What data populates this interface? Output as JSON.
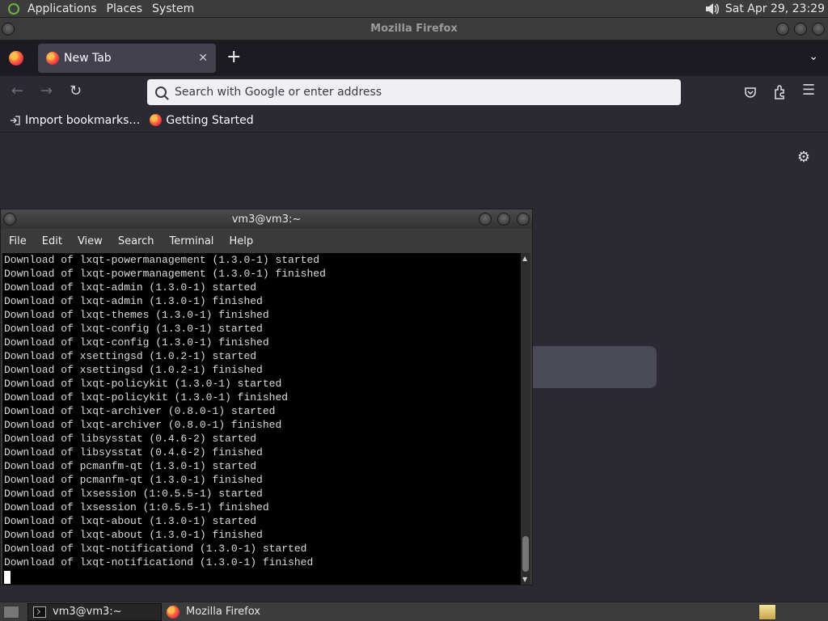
{
  "top_panel": {
    "menus": [
      "Applications",
      "Places",
      "System"
    ],
    "clock": "Sat Apr 29, 23:29"
  },
  "firefox": {
    "window_title": "Mozilla Firefox",
    "tab_title": "New Tab",
    "url_placeholder": "Search with Google or enter address",
    "bookmarks": [
      "Import bookmarks…",
      "Getting Started"
    ]
  },
  "terminal": {
    "title": "vm3@vm3:~",
    "menus": [
      "File",
      "Edit",
      "View",
      "Search",
      "Terminal",
      "Help"
    ],
    "lines": [
      "Download of lxqt-powermanagement (1.3.0-1) started",
      "Download of lxqt-powermanagement (1.3.0-1) finished",
      "Download of lxqt-admin (1.3.0-1) started",
      "Download of lxqt-admin (1.3.0-1) finished",
      "Download of lxqt-themes (1.3.0-1) finished",
      "Download of lxqt-config (1.3.0-1) started",
      "Download of lxqt-config (1.3.0-1) finished",
      "Download of xsettingsd (1.0.2-1) started",
      "Download of xsettingsd (1.0.2-1) finished",
      "Download of lxqt-policykit (1.3.0-1) started",
      "Download of lxqt-policykit (1.3.0-1) finished",
      "Download of lxqt-archiver (0.8.0-1) started",
      "Download of lxqt-archiver (0.8.0-1) finished",
      "Download of libsysstat (0.4.6-2) started",
      "Download of libsysstat (0.4.6-2) finished",
      "Download of pcmanfm-qt (1.3.0-1) started",
      "Download of pcmanfm-qt (1.3.0-1) finished",
      "Download of lxsession (1:0.5.5-1) started",
      "Download of lxsession (1:0.5.5-1) finished",
      "Download of lxqt-about (1.3.0-1) started",
      "Download of lxqt-about (1.3.0-1) finished",
      "Download of lxqt-notificationd (1.3.0-1) started",
      "Download of lxqt-notificationd (1.3.0-1) finished"
    ]
  },
  "taskbar": {
    "tasks": [
      "vm3@vm3:~",
      "Mozilla Firefox"
    ]
  }
}
